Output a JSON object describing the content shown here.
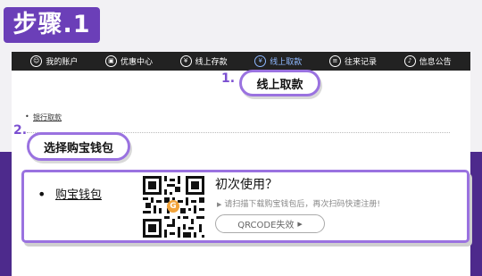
{
  "step_badge": "步骤.1",
  "nav": {
    "items": [
      {
        "label": "我的账户",
        "icon": "user-icon",
        "active": false
      },
      {
        "label": "优惠中心",
        "icon": "gift-icon",
        "active": false
      },
      {
        "label": "线上存款",
        "icon": "deposit-icon",
        "active": false
      },
      {
        "label": "线上取款",
        "icon": "withdraw-icon",
        "active": true
      },
      {
        "label": "往来记录",
        "icon": "records-icon",
        "active": false
      },
      {
        "label": "信息公告",
        "icon": "bell-icon",
        "active": false
      }
    ]
  },
  "callouts": {
    "one_number": "1.",
    "one_label": "线上取款",
    "two_number": "2.",
    "two_label": "选择购宝钱包"
  },
  "breadcrumb": {
    "label": "银行取款"
  },
  "panel": {
    "link": "购宝钱包",
    "qr_logo": "G",
    "first_use": "初次使用？",
    "hint": "请扫描下载购宝钱包后，再次扫码快速注册!",
    "qr_button": "QRCODE失效"
  },
  "colors": {
    "accent": "#9a72e0",
    "badge": "#6b3fb8",
    "navbar": "#222222",
    "active_nav": "#8fb8ff",
    "background_band": "#4d2a8c"
  }
}
